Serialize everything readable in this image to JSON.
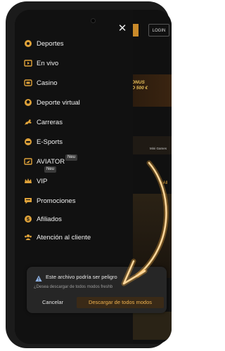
{
  "colors": {
    "accent": "#e0a33a",
    "drawer_bg": "#111111",
    "text": "#f2f2f2",
    "arrow": "#f2a93b"
  },
  "header": {
    "close_icon": "close-icon",
    "login_label": "LOGIN"
  },
  "background": {
    "banner_line1": "ONUS",
    "banner_line2": "O 500 €",
    "mini_games": "Mini Games",
    "ver_all": "e All"
  },
  "menu": {
    "items": [
      {
        "label": "Deportes",
        "icon": "soccer-ball-icon"
      },
      {
        "label": "En vivo",
        "icon": "play-screen-icon"
      },
      {
        "label": "Casino",
        "icon": "slot-icon"
      },
      {
        "label": "Deporte virtual",
        "icon": "virtual-ball-icon"
      },
      {
        "label": "Carreras",
        "icon": "horse-racing-icon"
      },
      {
        "label": "E-Sports",
        "icon": "controller-icon"
      },
      {
        "label": "AVIATOR",
        "icon": "plane-icon",
        "badge": "Neu"
      },
      {
        "label": "VIP",
        "icon": "crown-icon",
        "badge": "Neu"
      },
      {
        "label": "Promociones",
        "icon": "promo-icon"
      },
      {
        "label": "Afiliados",
        "icon": "affiliate-icon"
      },
      {
        "label": "Atención al cliente",
        "icon": "support-icon"
      }
    ]
  },
  "download_popup": {
    "title": "Este archivo podría ser peligro",
    "subtitle": "¿Desea descargar de todos modos freshb",
    "cancel_label": "Cancelar",
    "download_label": "Descargar de todos modos"
  }
}
